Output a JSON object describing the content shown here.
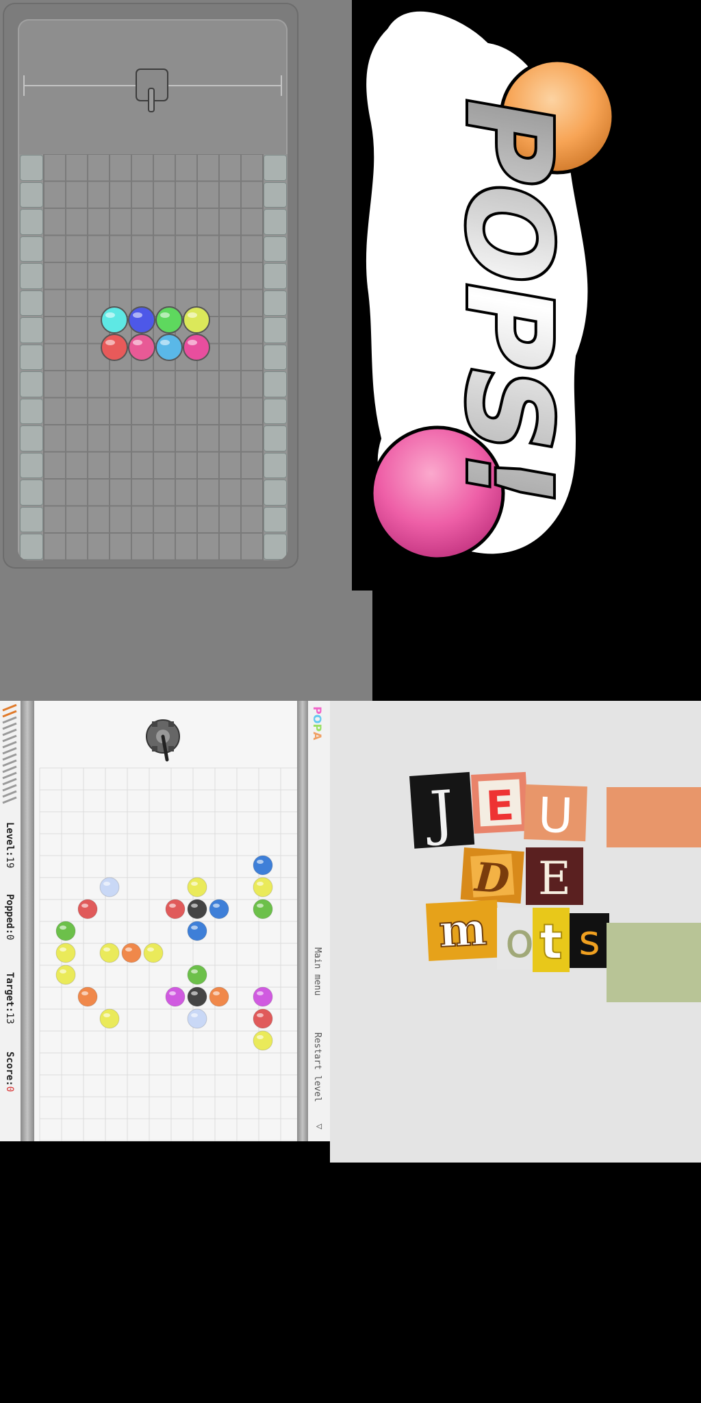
{
  "pops_logo": {
    "text": "POPS!"
  },
  "game1": {
    "grid": {
      "cols": 13,
      "rows": 15
    },
    "balls": [
      {
        "row": 0,
        "col": 0,
        "color": "#5ee8e4"
      },
      {
        "row": 0,
        "col": 1,
        "color": "#4d58e8"
      },
      {
        "row": 0,
        "col": 2,
        "color": "#5ed85e"
      },
      {
        "row": 0,
        "col": 3,
        "color": "#dbe85a"
      },
      {
        "row": 1,
        "col": 0,
        "color": "#e85a5a"
      },
      {
        "row": 1,
        "col": 1,
        "color": "#e85a96"
      },
      {
        "row": 1,
        "col": 2,
        "color": "#5ab8e8"
      },
      {
        "row": 1,
        "col": 3,
        "color": "#e84e9e"
      }
    ]
  },
  "game2": {
    "logo_text": "POPA",
    "stats": {
      "level_label": "Level:",
      "level_value": "19",
      "popped_label": "Popped:",
      "popped_value": "0",
      "target_label": "Target:",
      "target_value": "13",
      "score_label": "Score:",
      "score_value": "0"
    },
    "menu": {
      "main_menu": "Main menu",
      "restart_level": "Restart level"
    },
    "balls": [
      {
        "col": 9,
        "row": 4,
        "color": "#3e7fd8"
      },
      {
        "col": 2,
        "row": 5,
        "color": "#c9d8f6"
      },
      {
        "col": 6,
        "row": 5,
        "color": "#eaea5a"
      },
      {
        "col": 9,
        "row": 5,
        "color": "#eaea5a"
      },
      {
        "col": 1,
        "row": 6,
        "color": "#e05a5a"
      },
      {
        "col": 5,
        "row": 6,
        "color": "#e05a5a"
      },
      {
        "col": 6,
        "row": 6,
        "color": "#444444"
      },
      {
        "col": 7,
        "row": 6,
        "color": "#3e7fd8"
      },
      {
        "col": 9,
        "row": 6,
        "color": "#6cc04a"
      },
      {
        "col": 0,
        "row": 7,
        "color": "#6cc04a"
      },
      {
        "col": 6,
        "row": 7,
        "color": "#3e7fd8"
      },
      {
        "col": 0,
        "row": 8,
        "color": "#eaea5a"
      },
      {
        "col": 2,
        "row": 8,
        "color": "#eaea5a"
      },
      {
        "col": 3,
        "row": 8,
        "color": "#f0884a"
      },
      {
        "col": 4,
        "row": 8,
        "color": "#eaea5a"
      },
      {
        "col": 0,
        "row": 9,
        "color": "#eaea5a"
      },
      {
        "col": 6,
        "row": 9,
        "color": "#6cc04a"
      },
      {
        "col": 1,
        "row": 10,
        "color": "#f0884a"
      },
      {
        "col": 5,
        "row": 10,
        "color": "#d05ae0"
      },
      {
        "col": 6,
        "row": 10,
        "color": "#444444"
      },
      {
        "col": 7,
        "row": 10,
        "color": "#f0884a"
      },
      {
        "col": 9,
        "row": 10,
        "color": "#d05ae0"
      },
      {
        "col": 2,
        "row": 11,
        "color": "#eaea5a"
      },
      {
        "col": 6,
        "row": 11,
        "color": "#c9d8f6"
      },
      {
        "col": 9,
        "row": 11,
        "color": "#e05a5a"
      },
      {
        "col": 9,
        "row": 12,
        "color": "#eaea5a"
      }
    ]
  },
  "jeu_de_mots": {
    "line1": [
      "J",
      "E",
      "U"
    ],
    "line2": [
      "D",
      "E"
    ],
    "line3": [
      "m",
      "o",
      "t",
      "s"
    ]
  },
  "colors": {
    "background": "#000000",
    "panel_gray": "#808080",
    "pops_orange": "#f7a455",
    "pops_pink": "#ee5fa7"
  }
}
